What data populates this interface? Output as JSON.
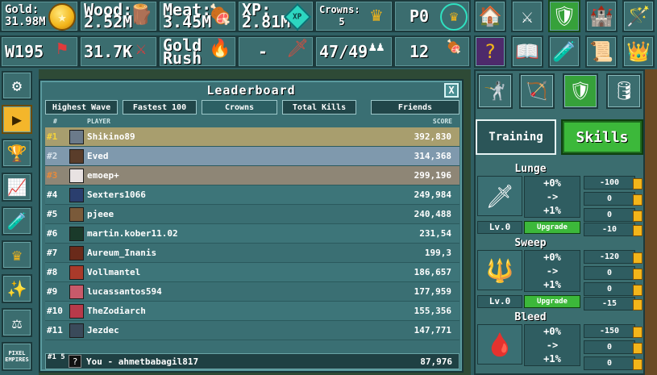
{
  "resources": {
    "gold": {
      "label": "Gold:",
      "value": "31.98M"
    },
    "wood": {
      "label": "Wood:",
      "value": "2.52M"
    },
    "meat": {
      "label": "Meat:",
      "value": "3.45M"
    },
    "xp": {
      "label": "XP:",
      "value": "2.81M"
    },
    "crowns": {
      "label": "Crowns:",
      "value": "5"
    },
    "prestige": "P0"
  },
  "row2": {
    "wave": "W195",
    "kills": "31.7K",
    "gold_rush": "Gold Rush",
    "dash": "-",
    "army": "47/49",
    "count": "12"
  },
  "leaderboard": {
    "title": "Leaderboard",
    "close": "X",
    "tabs": [
      "Highest Wave",
      "Fastest 100",
      "Crowns",
      "Total Kills",
      "Friends"
    ],
    "header_rank": "#",
    "header_player": "PLAYER",
    "header_score": "SCORE",
    "rows": [
      {
        "rank": "#1",
        "name": "Shikino89",
        "score": "392,830"
      },
      {
        "rank": "#2",
        "name": "Eved",
        "score": "314,368"
      },
      {
        "rank": "#3",
        "name": "emoep+",
        "score": "299,196"
      },
      {
        "rank": "#4",
        "name": "Sexters1066",
        "score": "249,984"
      },
      {
        "rank": "#5",
        "name": "pjeee",
        "score": "240,488"
      },
      {
        "rank": "#6",
        "name": "martin.kober11.02",
        "score": "231,54"
      },
      {
        "rank": "#7",
        "name": "Aureum_Inanis",
        "score": "199,3"
      },
      {
        "rank": "#8",
        "name": "Vollmantel",
        "score": "186,657"
      },
      {
        "rank": "#9",
        "name": "lucassantos594",
        "score": "177,959"
      },
      {
        "rank": "#10",
        "name": "TheZodiarch",
        "score": "155,356"
      },
      {
        "rank": "#11",
        "name": "Jezdec",
        "score": "147,771"
      }
    ],
    "you": {
      "rank": "#1 5",
      "avatar": "?",
      "name": "You - ahmetbabagil817",
      "score": "87,976"
    }
  },
  "right": {
    "training": "Training",
    "skills": "Skills",
    "skill_list": [
      {
        "title": "Lunge",
        "fx1": "+0%",
        "fx2": "->",
        "fx3": "+1%",
        "level": "Lv.0",
        "upgrade": "Upgrade",
        "costs": [
          "-100",
          "0",
          "0",
          "-10"
        ]
      },
      {
        "title": "Sweep",
        "fx1": "+0%",
        "fx2": "->",
        "fx3": "+1%",
        "level": "Lv.0",
        "upgrade": "Upgrade",
        "costs": [
          "-120",
          "0",
          "0",
          "-15"
        ]
      },
      {
        "title": "Bleed",
        "fx1": "+0%",
        "fx2": "->",
        "fx3": "+1%",
        "costs": [
          "-150",
          "0",
          "0"
        ]
      }
    ]
  },
  "sidebar_label": "PIXEL EMPIRES"
}
